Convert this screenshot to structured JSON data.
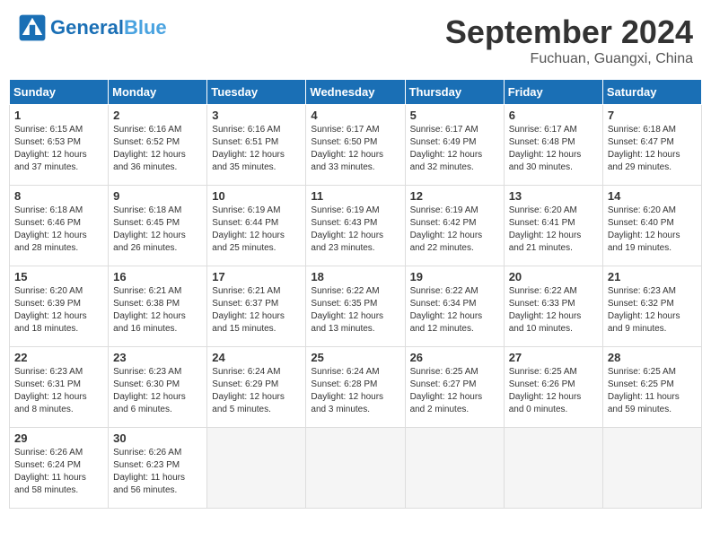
{
  "header": {
    "logo_general": "General",
    "logo_blue": "Blue",
    "month_title": "September 2024",
    "subtitle": "Fuchuan, Guangxi, China"
  },
  "weekdays": [
    "Sunday",
    "Monday",
    "Tuesday",
    "Wednesday",
    "Thursday",
    "Friday",
    "Saturday"
  ],
  "weeks": [
    [
      {
        "day": "1",
        "sunrise": "6:15 AM",
        "sunset": "6:53 PM",
        "daylight": "12 hours and 37 minutes."
      },
      {
        "day": "2",
        "sunrise": "6:16 AM",
        "sunset": "6:52 PM",
        "daylight": "12 hours and 36 minutes."
      },
      {
        "day": "3",
        "sunrise": "6:16 AM",
        "sunset": "6:51 PM",
        "daylight": "12 hours and 35 minutes."
      },
      {
        "day": "4",
        "sunrise": "6:17 AM",
        "sunset": "6:50 PM",
        "daylight": "12 hours and 33 minutes."
      },
      {
        "day": "5",
        "sunrise": "6:17 AM",
        "sunset": "6:49 PM",
        "daylight": "12 hours and 32 minutes."
      },
      {
        "day": "6",
        "sunrise": "6:17 AM",
        "sunset": "6:48 PM",
        "daylight": "12 hours and 30 minutes."
      },
      {
        "day": "7",
        "sunrise": "6:18 AM",
        "sunset": "6:47 PM",
        "daylight": "12 hours and 29 minutes."
      }
    ],
    [
      {
        "day": "8",
        "sunrise": "6:18 AM",
        "sunset": "6:46 PM",
        "daylight": "12 hours and 28 minutes."
      },
      {
        "day": "9",
        "sunrise": "6:18 AM",
        "sunset": "6:45 PM",
        "daylight": "12 hours and 26 minutes."
      },
      {
        "day": "10",
        "sunrise": "6:19 AM",
        "sunset": "6:44 PM",
        "daylight": "12 hours and 25 minutes."
      },
      {
        "day": "11",
        "sunrise": "6:19 AM",
        "sunset": "6:43 PM",
        "daylight": "12 hours and 23 minutes."
      },
      {
        "day": "12",
        "sunrise": "6:19 AM",
        "sunset": "6:42 PM",
        "daylight": "12 hours and 22 minutes."
      },
      {
        "day": "13",
        "sunrise": "6:20 AM",
        "sunset": "6:41 PM",
        "daylight": "12 hours and 21 minutes."
      },
      {
        "day": "14",
        "sunrise": "6:20 AM",
        "sunset": "6:40 PM",
        "daylight": "12 hours and 19 minutes."
      }
    ],
    [
      {
        "day": "15",
        "sunrise": "6:20 AM",
        "sunset": "6:39 PM",
        "daylight": "12 hours and 18 minutes."
      },
      {
        "day": "16",
        "sunrise": "6:21 AM",
        "sunset": "6:38 PM",
        "daylight": "12 hours and 16 minutes."
      },
      {
        "day": "17",
        "sunrise": "6:21 AM",
        "sunset": "6:37 PM",
        "daylight": "12 hours and 15 minutes."
      },
      {
        "day": "18",
        "sunrise": "6:22 AM",
        "sunset": "6:35 PM",
        "daylight": "12 hours and 13 minutes."
      },
      {
        "day": "19",
        "sunrise": "6:22 AM",
        "sunset": "6:34 PM",
        "daylight": "12 hours and 12 minutes."
      },
      {
        "day": "20",
        "sunrise": "6:22 AM",
        "sunset": "6:33 PM",
        "daylight": "12 hours and 10 minutes."
      },
      {
        "day": "21",
        "sunrise": "6:23 AM",
        "sunset": "6:32 PM",
        "daylight": "12 hours and 9 minutes."
      }
    ],
    [
      {
        "day": "22",
        "sunrise": "6:23 AM",
        "sunset": "6:31 PM",
        "daylight": "12 hours and 8 minutes."
      },
      {
        "day": "23",
        "sunrise": "6:23 AM",
        "sunset": "6:30 PM",
        "daylight": "12 hours and 6 minutes."
      },
      {
        "day": "24",
        "sunrise": "6:24 AM",
        "sunset": "6:29 PM",
        "daylight": "12 hours and 5 minutes."
      },
      {
        "day": "25",
        "sunrise": "6:24 AM",
        "sunset": "6:28 PM",
        "daylight": "12 hours and 3 minutes."
      },
      {
        "day": "26",
        "sunrise": "6:25 AM",
        "sunset": "6:27 PM",
        "daylight": "12 hours and 2 minutes."
      },
      {
        "day": "27",
        "sunrise": "6:25 AM",
        "sunset": "6:26 PM",
        "daylight": "12 hours and 0 minutes."
      },
      {
        "day": "28",
        "sunrise": "6:25 AM",
        "sunset": "6:25 PM",
        "daylight": "11 hours and 59 minutes."
      }
    ],
    [
      {
        "day": "29",
        "sunrise": "6:26 AM",
        "sunset": "6:24 PM",
        "daylight": "11 hours and 58 minutes."
      },
      {
        "day": "30",
        "sunrise": "6:26 AM",
        "sunset": "6:23 PM",
        "daylight": "11 hours and 56 minutes."
      },
      null,
      null,
      null,
      null,
      null
    ]
  ]
}
